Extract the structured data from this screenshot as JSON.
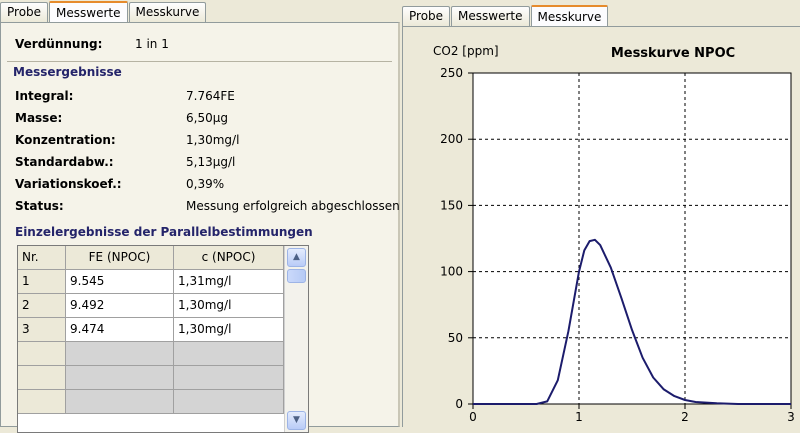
{
  "left_tabs": [
    "Probe",
    "Messwerte",
    "Messkurve"
  ],
  "left_active_tab": 1,
  "dilution": {
    "label": "Verdünnung:",
    "value": "1 in 1"
  },
  "results": {
    "title": "Messergebnisse",
    "rows": [
      {
        "label": "Integral:",
        "value": "7.764FE"
      },
      {
        "label": "Masse:",
        "value": "6,50µg"
      },
      {
        "label": "Konzentration:",
        "value": "1,30mg/l"
      },
      {
        "label": "Standardabw.:",
        "value": "5,13µg/l"
      },
      {
        "label": "Variationskoef.:",
        "value": "0,39%"
      },
      {
        "label": "Status:",
        "value": "Messung erfolgreich abgeschlossen"
      }
    ]
  },
  "single_results": {
    "title": "Einzelergebnisse der Parallelbestimmungen",
    "columns": [
      "Nr.",
      "FE (NPOC)",
      "c (NPOC)"
    ],
    "rows": [
      [
        "1",
        "9.545",
        "1,31mg/l"
      ],
      [
        "2",
        "9.492",
        "1,30mg/l"
      ],
      [
        "3",
        "9.474",
        "1,30mg/l"
      ]
    ],
    "empty_rows": 3
  },
  "right_tabs": [
    "Probe",
    "Messwerte",
    "Messkurve"
  ],
  "right_active_tab": 2,
  "chart_data": {
    "type": "line",
    "title": "Messkurve NPOC",
    "ylabel": "CO2 [ppm]",
    "xlabel": "",
    "xlim": [
      0,
      3
    ],
    "ylim": [
      0,
      250
    ],
    "x_ticks": [
      0,
      1,
      2,
      3
    ],
    "y_ticks": [
      0,
      50,
      100,
      150,
      200,
      250
    ],
    "grid": true,
    "line_color": "#1c1c6c",
    "series": [
      {
        "x": [
          0,
          0.6,
          0.7,
          0.8,
          0.9,
          1.0,
          1.05,
          1.1,
          1.15,
          1.2,
          1.3,
          1.4,
          1.5,
          1.6,
          1.7,
          1.8,
          1.9,
          2.0,
          2.1,
          2.3,
          2.5,
          3.0
        ],
        "y": [
          0,
          0,
          2,
          18,
          55,
          100,
          116,
          123,
          124,
          120,
          103,
          80,
          56,
          35,
          20,
          11,
          6,
          3,
          1.5,
          0.5,
          0,
          0
        ]
      }
    ]
  }
}
